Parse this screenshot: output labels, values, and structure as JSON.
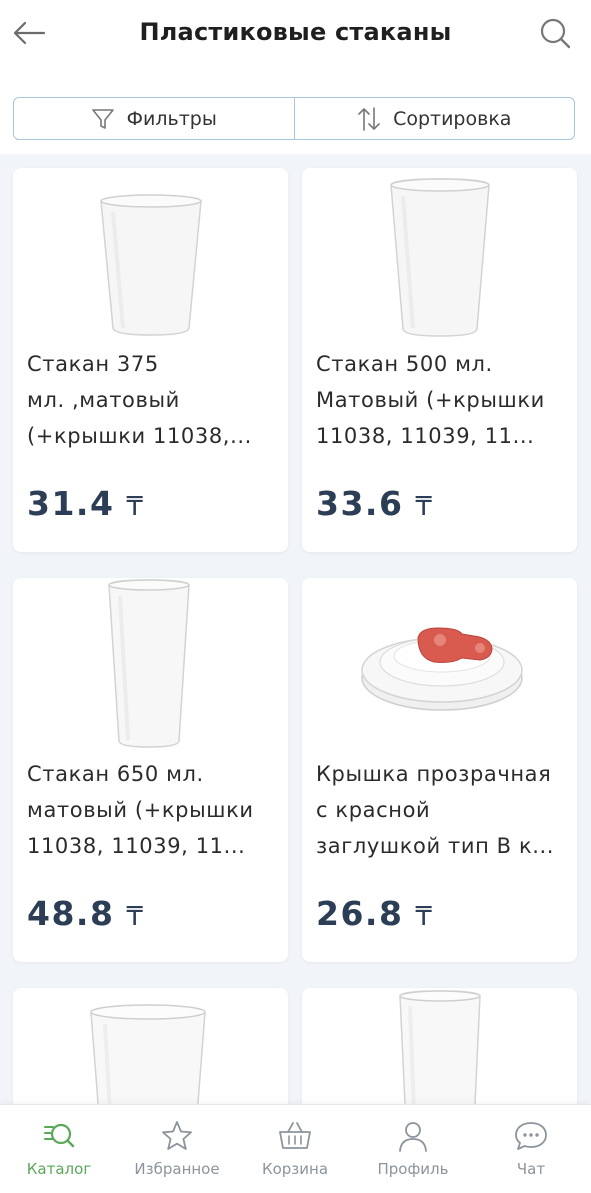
{
  "header": {
    "title": "Пластиковые стаканы"
  },
  "controls": {
    "filters_label": "Фильтры",
    "sort_label": "Сортировка"
  },
  "products": [
    {
      "name": "Стакан 375\nмл. ,матовый\n(+крышки 11038,...",
      "price": "31.4",
      "currency": "₸",
      "image": "frosted-cup"
    },
    {
      "name": "Стакан 500 мл.\nМатовый  (+крышки\n11038, 11039, 11...",
      "price": "33.6",
      "currency": "₸",
      "image": "frosted-cup"
    },
    {
      "name": "Стакан  650 мл.\nматовый (+крышки\n11038, 11039, 11...",
      "price": "48.8",
      "currency": "₸",
      "image": "tall-frosted-cup"
    },
    {
      "name": "Крышка прозрачная\nс красной\nзаглушкой тип В к...",
      "price": "26.8",
      "currency": "₸",
      "image": "lid-with-red-plug"
    },
    {
      "image": "clear-cup"
    },
    {
      "image": "clear-cup"
    }
  ],
  "tabbar": {
    "items": [
      {
        "label": "Каталог",
        "icon": "catalog-search-icon",
        "active": true
      },
      {
        "label": "Избранное",
        "icon": "star-icon",
        "active": false
      },
      {
        "label": "Корзина",
        "icon": "basket-icon",
        "active": false
      },
      {
        "label": "Профиль",
        "icon": "profile-icon",
        "active": false
      },
      {
        "label": "Чат",
        "icon": "chat-icon",
        "active": false
      }
    ]
  },
  "colors": {
    "accent": "#5aa85a",
    "price": "#2b3e55",
    "border": "#a9c4dd",
    "background": "#f1f4f8",
    "lid_plug": "#d95b4f"
  }
}
